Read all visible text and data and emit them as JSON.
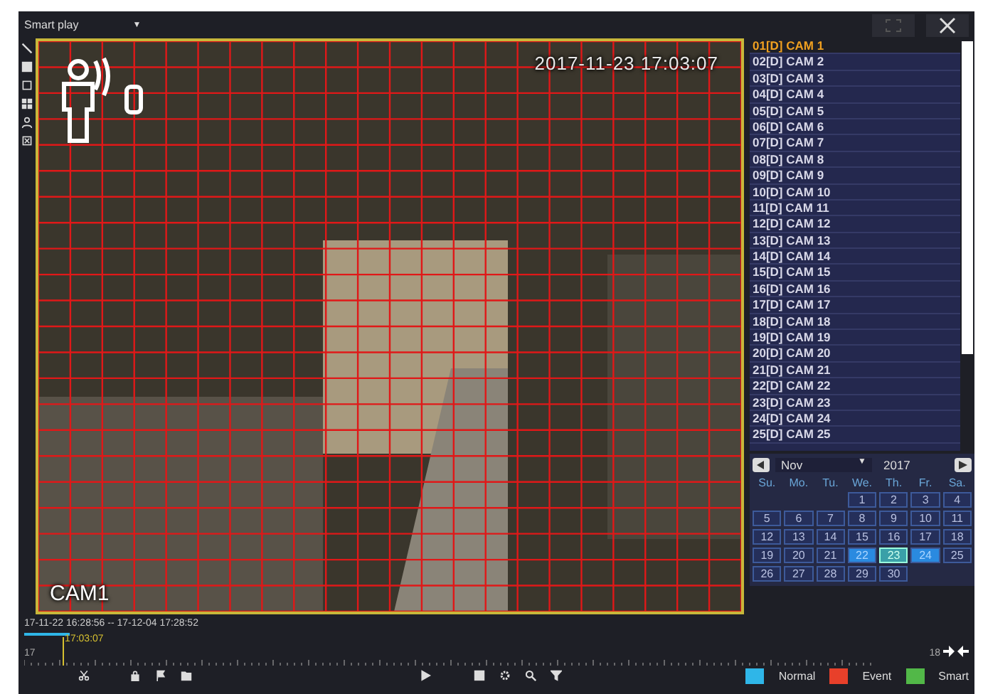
{
  "top_bar": {
    "mode": "Smart play",
    "caret": "▼"
  },
  "video": {
    "timestamp": "2017-11-23 17:03:07",
    "camera_label": "CAM1"
  },
  "camera_list": [
    {
      "label": "01[D] CAM 1",
      "selected": true
    },
    {
      "label": "02[D] CAM 2",
      "selected": false
    },
    {
      "label": "03[D] CAM 3",
      "selected": false
    },
    {
      "label": "04[D] CAM 4",
      "selected": false
    },
    {
      "label": "05[D] CAM 5",
      "selected": false
    },
    {
      "label": "06[D] CAM 6",
      "selected": false
    },
    {
      "label": "07[D] CAM 7",
      "selected": false
    },
    {
      "label": "08[D] CAM 8",
      "selected": false
    },
    {
      "label": "09[D] CAM 9",
      "selected": false
    },
    {
      "label": "10[D] CAM 10",
      "selected": false
    },
    {
      "label": "11[D] CAM 11",
      "selected": false
    },
    {
      "label": "12[D] CAM 12",
      "selected": false
    },
    {
      "label": "13[D] CAM 13",
      "selected": false
    },
    {
      "label": "14[D] CAM 14",
      "selected": false
    },
    {
      "label": "15[D] CAM 15",
      "selected": false
    },
    {
      "label": "16[D] CAM 16",
      "selected": false
    },
    {
      "label": "17[D] CAM 17",
      "selected": false
    },
    {
      "label": "18[D] CAM 18",
      "selected": false
    },
    {
      "label": "19[D] CAM 19",
      "selected": false
    },
    {
      "label": "20[D] CAM 20",
      "selected": false
    },
    {
      "label": "21[D] CAM 21",
      "selected": false
    },
    {
      "label": "22[D] CAM 22",
      "selected": false
    },
    {
      "label": "23[D] CAM 23",
      "selected": false
    },
    {
      "label": "24[D] CAM 24",
      "selected": false
    },
    {
      "label": "25[D] CAM 25",
      "selected": false
    }
  ],
  "calendar": {
    "month": "Nov",
    "month_caret": "▼",
    "year": "2017",
    "weekdays": [
      "Su.",
      "Mo.",
      "Tu.",
      "We.",
      "Th.",
      "Fr.",
      "Sa."
    ],
    "days": [
      {
        "day": "1",
        "highlighted": false,
        "selected": false
      },
      {
        "day": "2",
        "highlighted": false,
        "selected": false
      },
      {
        "day": "3",
        "highlighted": false,
        "selected": false
      },
      {
        "day": "4",
        "highlighted": false,
        "selected": false
      },
      {
        "day": "5",
        "highlighted": false,
        "selected": false
      },
      {
        "day": "6",
        "highlighted": false,
        "selected": false
      },
      {
        "day": "7",
        "highlighted": false,
        "selected": false
      },
      {
        "day": "8",
        "highlighted": false,
        "selected": false
      },
      {
        "day": "9",
        "highlighted": false,
        "selected": false
      },
      {
        "day": "10",
        "highlighted": false,
        "selected": false
      },
      {
        "day": "11",
        "highlighted": false,
        "selected": false
      },
      {
        "day": "12",
        "highlighted": false,
        "selected": false
      },
      {
        "day": "13",
        "highlighted": false,
        "selected": false
      },
      {
        "day": "14",
        "highlighted": false,
        "selected": false
      },
      {
        "day": "15",
        "highlighted": false,
        "selected": false
      },
      {
        "day": "16",
        "highlighted": false,
        "selected": false
      },
      {
        "day": "17",
        "highlighted": false,
        "selected": false
      },
      {
        "day": "18",
        "highlighted": false,
        "selected": false
      },
      {
        "day": "19",
        "highlighted": false,
        "selected": false
      },
      {
        "day": "20",
        "highlighted": false,
        "selected": false
      },
      {
        "day": "21",
        "highlighted": false,
        "selected": false
      },
      {
        "day": "22",
        "highlighted": true,
        "selected": false
      },
      {
        "day": "23",
        "highlighted": true,
        "selected": true
      },
      {
        "day": "24",
        "highlighted": true,
        "selected": false
      },
      {
        "day": "25",
        "highlighted": false,
        "selected": false
      },
      {
        "day": "26",
        "highlighted": false,
        "selected": false
      },
      {
        "day": "27",
        "highlighted": false,
        "selected": false
      },
      {
        "day": "28",
        "highlighted": false,
        "selected": false
      },
      {
        "day": "29",
        "highlighted": false,
        "selected": false
      },
      {
        "day": "30",
        "highlighted": false,
        "selected": false
      }
    ]
  },
  "timeline": {
    "range": "17-11-22 16:28:56 -- 17-12-04 17:28:52",
    "cursor_time": "17:03:07",
    "level": 0.04,
    "start_label": "17",
    "end_label": "18"
  },
  "legend": [
    {
      "label": "Normal",
      "color": "#2fb6e8"
    },
    {
      "label": "Event",
      "color": "#e8402a"
    },
    {
      "label": "Smart",
      "color": "#52b848"
    }
  ]
}
